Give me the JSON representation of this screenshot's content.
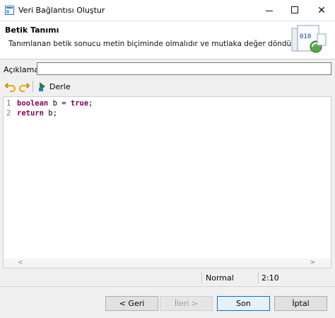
{
  "window": {
    "title": "Veri Bağlantısı Oluştur"
  },
  "header": {
    "title": "Betik Tanımı",
    "description": "Tanımlanan betik sonucu metin biçiminde olmalıdır ve mutlaka değer döndürmelidir.",
    "image_text": "010"
  },
  "description_field": {
    "label": "Açıklama",
    "value": ""
  },
  "toolbar": {
    "compile_label": "Derle"
  },
  "editor": {
    "lines": [
      {
        "number": "1",
        "keyword": "boolean",
        "rest": " b = ",
        "keyword2": "true",
        "rest2": ";"
      },
      {
        "number": "2",
        "keyword": "return",
        "rest": " b;",
        "keyword2": "",
        "rest2": ""
      }
    ]
  },
  "status": {
    "mode": "Normal",
    "position": "2:10"
  },
  "buttons": {
    "back": "< Geri",
    "next": "İleri >",
    "finish": "Son",
    "cancel": "İptal"
  },
  "colors": {
    "keyword": "#7f0055",
    "accent": "#0078d7"
  }
}
